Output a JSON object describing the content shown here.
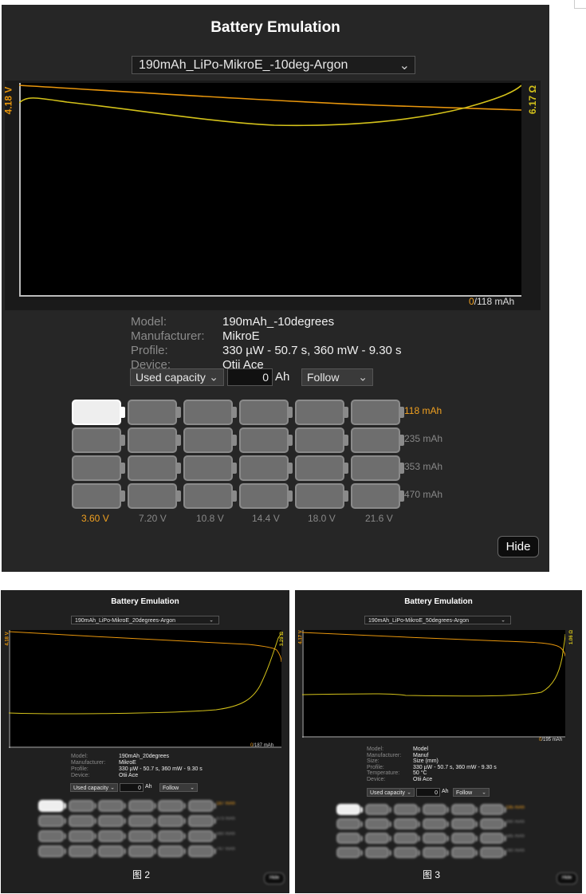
{
  "main": {
    "title": "Battery Emulation",
    "profile_select": "190mAh_LiPo-MikroE_-10deg-Argon",
    "axis_left": "4.18 V",
    "axis_right": "6.17 Ω",
    "capacity_used": "0",
    "capacity_total": "/118 mAh",
    "info": {
      "model_label": "Model:",
      "model": "190mAh_-10degrees",
      "manufacturer_label": "Manufacturer:",
      "manufacturer": "MikroE",
      "profile_label": "Profile:",
      "profile": "330 µW - 50.7 s, 360 mW - 9.30 s",
      "device_label": "Device:",
      "device": "Otii Ace"
    },
    "mode_select": "Used capacity",
    "capacity_value": "0",
    "capacity_unit": "Ah",
    "follow_select": "Follow",
    "row_labels": [
      "118 mAh",
      "235 mAh",
      "353 mAh",
      "470 mAh"
    ],
    "col_labels": [
      "3.60 V",
      "7.20 V",
      "10.8 V",
      "14.4 V",
      "18.0 V",
      "21.6 V"
    ],
    "hide_label": "Hide"
  },
  "fig2": {
    "title": "Battery Emulation",
    "profile_select": "190mAh_LiPo-MikroE_20degrees-Argon",
    "axis_left": "4.18 V",
    "axis_right": "3.29 Ω",
    "capacity_used": "0",
    "capacity_total": "/187 mAh",
    "info": {
      "model_label": "Model:",
      "model": "190mAh_20degrees",
      "manufacturer_label": "Manufacturer:",
      "manufacturer": "MikroE",
      "profile_label": "Profile:",
      "profile": "330 µW - 50.7 s, 360 mW - 9.30 s",
      "device_label": "Device:",
      "device": "Otii Ace"
    },
    "mode_select": "Used capacity",
    "capacity_value": "0",
    "capacity_unit": "Ah",
    "follow_select": "Follow",
    "row_labels": [
      "187 mAh",
      "373 mAh",
      "560 mAh",
      "747 mAh"
    ],
    "hide_label": "Hide",
    "caption": "图 2"
  },
  "fig3": {
    "title": "Battery Emulation",
    "profile_select": "190mAh_LiPo-MikroE_50degrees-Argon",
    "axis_left": "4.17 V",
    "axis_right": "1.06 Ω",
    "capacity_used": "0",
    "capacity_total": "/195 mAh",
    "info": {
      "model_label": "Model:",
      "model": "Model",
      "manufacturer_label": "Manufacturer:",
      "manufacturer": "Manuf",
      "size_label": "Size:",
      "size": "Size (mm)",
      "profile_label": "Profile:",
      "profile": "330 µW - 50.7 s, 360 mW - 9.30 s",
      "temperature_label": "Temperature:",
      "temperature": "50 °C",
      "device_label": "Device:",
      "device": "Otii Ace"
    },
    "mode_select": "Used capacity",
    "capacity_value": "0",
    "capacity_unit": "Ah",
    "follow_select": "Follow",
    "row_labels": [
      "195 mAh",
      "390 mAh",
      "585 mAh",
      "780 mAh"
    ],
    "hide_label": "Hide",
    "caption": "图 3"
  },
  "colors": {
    "voltage_curve": "#d4c21a",
    "resistance_curve": "#e8960c",
    "panel_bg": "#262626",
    "accent": "#f0a020"
  },
  "icons": {
    "dropdown": "chevron-down-icon",
    "battery": "battery-icon"
  }
}
